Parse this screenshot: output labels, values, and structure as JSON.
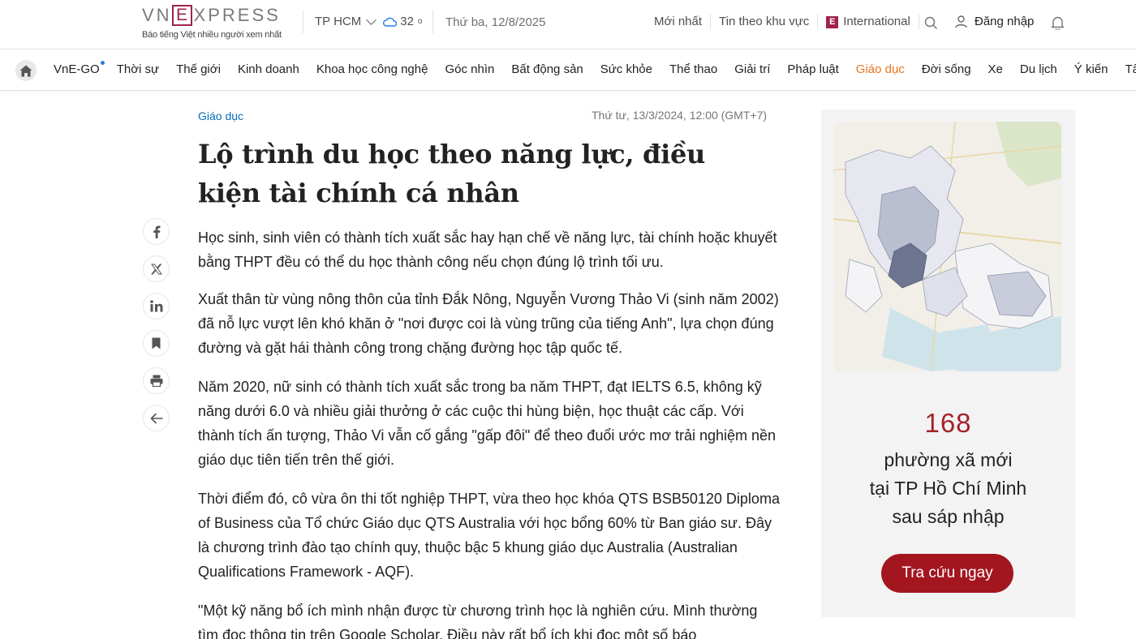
{
  "header": {
    "logo_text": "VNEXPRESS",
    "tagline": "Báo tiếng Việt nhiều người xem nhất",
    "location": "TP HCM",
    "temperature": "32",
    "temp_unit": "o",
    "date": "Thứ ba, 12/8/2025",
    "links": [
      "Mới nhất",
      "Tin theo khu vực"
    ],
    "international_label": "International",
    "login_label": "Đăng nhập",
    "colors": {
      "brand": "#9f224e"
    }
  },
  "nav": {
    "items": [
      "VnE-GO",
      "Thời sự",
      "Thế giới",
      "Kinh doanh",
      "Khoa học công nghệ",
      "Góc nhìn",
      "Bất động sản",
      "Sức khỏe",
      "Thể thao",
      "Giải trí",
      "Pháp luật",
      "Giáo dục",
      "Đời sống",
      "Xe",
      "Du lịch",
      "Ý kiến",
      "Tâm sự"
    ],
    "active": "Giáo dục",
    "active_color": "#e9741c"
  },
  "article": {
    "category": "Giáo dục",
    "published": "Thứ tư, 13/3/2024, 12:00 (GMT+7)",
    "title": "Lộ trình du học theo năng lực, điều kiện tài chính cá nhân",
    "paragraphs": [
      "Học sinh, sinh viên có thành tích xuất sắc hay hạn chế về năng lực, tài chính hoặc khuyết bằng THPT đều có thể du học thành công nếu chọn đúng lộ trình tối ưu.",
      "Xuất thân từ vùng nông thôn của tỉnh Đắk Nông, Nguyễn Vương Thảo Vi (sinh năm 2002) đã nỗ lực vượt lên khó khăn ở \"nơi được coi là vùng trũng của tiếng Anh\", lựa chọn đúng đường và gặt hái thành công trong chặng đường học tập quốc tế.",
      "Năm 2020, nữ sinh có thành tích xuất sắc trong ba năm THPT, đạt IELTS 6.5, không kỹ năng dưới 6.0 và nhiều giải thưởng ở các cuộc thi hùng biện, học thuật các cấp. Với thành tích ấn tượng, Thảo Vi vẫn cố gắng \"gấp đôi\" để theo đuổi ước mơ trải nghiệm nền giáo dục tiên tiến trên thế giới.",
      "Thời điểm đó, cô vừa ôn thi tốt nghiệp THPT, vừa theo học khóa QTS BSB50120 Diploma of Business của Tổ chức Giáo dục QTS Australia với học bổng 60% từ Ban giáo sư. Đây là chương trình đào tạo chính quy, thuộc bậc 5 khung giáo dục Australia (Australian Qualifications Framework - AQF).",
      "\"Một kỹ năng bổ ích mình nhận được từ chương trình học là nghiên cứu. Mình thường tìm đọc thông tin trên Google Scholar. Điều này rất bổ ích khi đọc một số báo"
    ]
  },
  "share": {
    "icons": [
      "facebook-icon",
      "x-icon",
      "linkedin-icon",
      "bookmark-icon",
      "print-icon",
      "back-arrow-icon"
    ]
  },
  "ad": {
    "number": "168",
    "line1": "phường xã mới",
    "line2": "tại TP Hồ Chí Minh",
    "line3": "sau sáp nhập",
    "button": "Tra cứu ngay",
    "button_color": "#a3161f"
  }
}
